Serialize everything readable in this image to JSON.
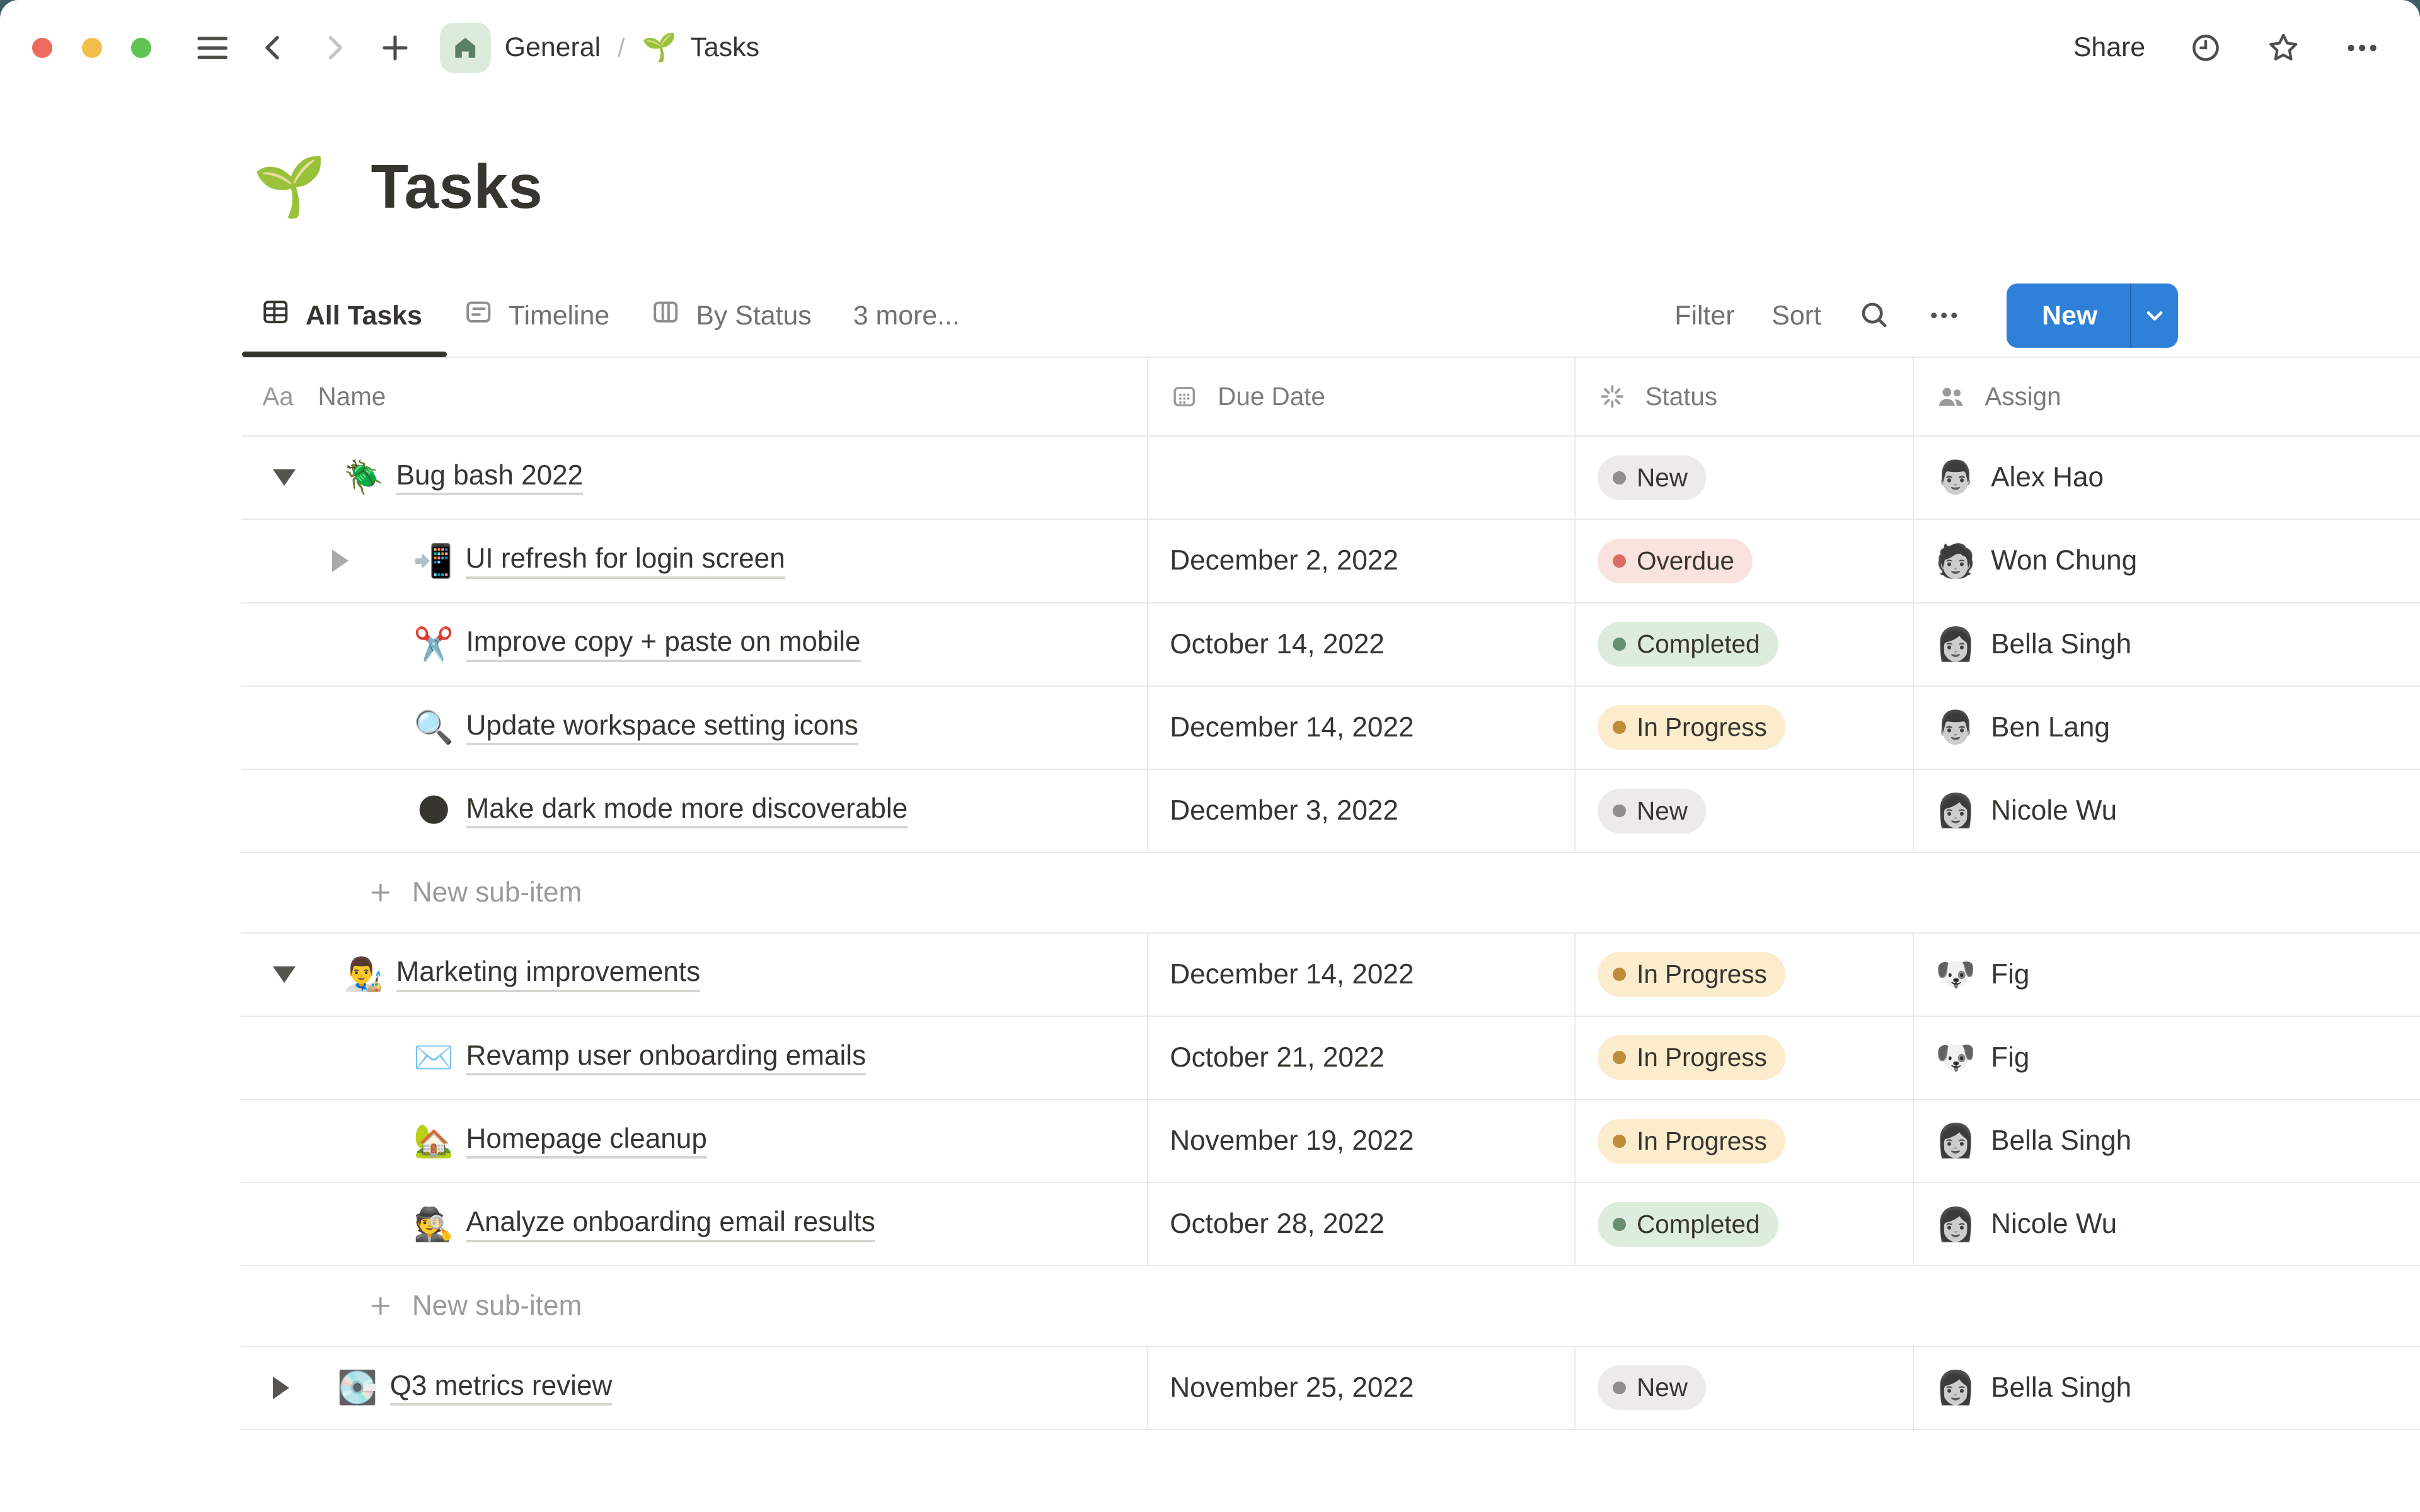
{
  "colors": {
    "desktop-bg": "#3F5E64",
    "accent-blue": "#2E80D9",
    "text-primary": "#37352F",
    "text-secondary": "#7D7C78",
    "text-muted": "#9B9A97",
    "divider": "#E9E9E7",
    "underline": "#D6D4CF",
    "pill-new-bg": "#ECEBE9",
    "pill-new-dot": "#8F8E8A",
    "pill-overdue-bg": "#FAE3DE",
    "pill-overdue-dot": "#D96C63",
    "pill-completed-bg": "#DEECDD",
    "pill-completed-dot": "#678F70",
    "pill-inprogress-bg": "#FAECCC",
    "pill-inprogress-dot": "#BE8D39",
    "traffic-red": "#ED6A5E",
    "traffic-yellow": "#F4BE4F",
    "traffic-green": "#61C354",
    "home-badge-bg": "#DDEBDC",
    "home-badge-glyph": "#5A8165"
  },
  "topbar": {
    "share_label": "Share",
    "icons": [
      "hamburger-icon",
      "back-chevron-icon",
      "forward-chevron-icon",
      "plus-icon",
      "clock-icon",
      "star-icon",
      "ellipsis-icon"
    ],
    "breadcrumb": {
      "workspace": "General",
      "workspace_icon": "home-icon",
      "separator": "/",
      "page_emoji": "🌱",
      "page": "Tasks"
    }
  },
  "page": {
    "emoji": "🌱",
    "title": "Tasks"
  },
  "tabs": [
    {
      "label": "All Tasks",
      "icon": "table-grid-icon",
      "active": true
    },
    {
      "label": "Timeline",
      "icon": "timeline-icon",
      "active": false
    },
    {
      "label": "By Status",
      "icon": "board-columns-icon",
      "active": false
    },
    {
      "label": "3 more...",
      "active": false
    }
  ],
  "controls": {
    "filter": "Filter",
    "sort": "Sort",
    "search_icon": "search-icon",
    "more_icon": "ellipsis-icon",
    "new": "New",
    "new_chevron": "chevron-down-icon"
  },
  "table": {
    "columns": [
      {
        "icon": "Aa",
        "label": "Name"
      },
      {
        "icon": "calendar-icon",
        "label": "Due Date"
      },
      {
        "icon": "status-spark-icon",
        "label": "Status"
      },
      {
        "icon": "people-icon",
        "label": "Assign"
      }
    ]
  },
  "rows": [
    {
      "type": "parent",
      "toggle": "expanded",
      "emoji": "🪲",
      "name": "Bug bash 2022",
      "date": "",
      "status": "New",
      "assignee": "Alex Hao",
      "avatar": "👨"
    },
    {
      "type": "child",
      "toggle": "collapsed",
      "emoji": "📲",
      "name": "UI refresh for login screen",
      "date": "December 2, 2022",
      "status": "Overdue",
      "assignee": "Won Chung",
      "avatar": "🧑"
    },
    {
      "type": "child",
      "emoji": "✂️",
      "name": "Improve copy + paste on mobile",
      "date": "October 14, 2022",
      "status": "Completed",
      "assignee": "Bella Singh",
      "avatar": "👩"
    },
    {
      "type": "child",
      "emoji": "🔍",
      "name": "Update workspace setting icons",
      "date": "December 14, 2022",
      "status": "In Progress",
      "assignee": "Ben Lang",
      "avatar": "👨"
    },
    {
      "type": "child",
      "emoji": "🌑",
      "name": "Make dark mode more discoverable",
      "date": "December 3, 2022",
      "status": "New",
      "assignee": "Nicole Wu",
      "avatar": "👩"
    },
    {
      "type": "subitem",
      "label": "New sub-item"
    },
    {
      "type": "parent",
      "toggle": "expanded",
      "emoji": "👨‍🎨",
      "name": "Marketing improvements",
      "date": "December 14, 2022",
      "status": "In Progress",
      "assignee": "Fig",
      "avatar": "🐶"
    },
    {
      "type": "child",
      "emoji": "✉️",
      "name": "Revamp user onboarding emails",
      "date": "October 21, 2022",
      "status": "In Progress",
      "assignee": "Fig",
      "avatar": "🐶"
    },
    {
      "type": "child",
      "emoji": "🏡",
      "name": "Homepage cleanup",
      "date": "November 19, 2022",
      "status": "In Progress",
      "assignee": "Bella Singh",
      "avatar": "👩"
    },
    {
      "type": "child",
      "emoji": "🕵️",
      "name": "Analyze onboarding email results",
      "date": "October 28, 2022",
      "status": "Completed",
      "assignee": "Nicole Wu",
      "avatar": "👩"
    },
    {
      "type": "subitem",
      "label": "New sub-item"
    },
    {
      "type": "parent",
      "toggle": "collapsed",
      "emoji": "💽",
      "name": "Q3 metrics review",
      "date": "November 25, 2022",
      "status": "New",
      "assignee": "Bella Singh",
      "avatar": "👩"
    }
  ]
}
